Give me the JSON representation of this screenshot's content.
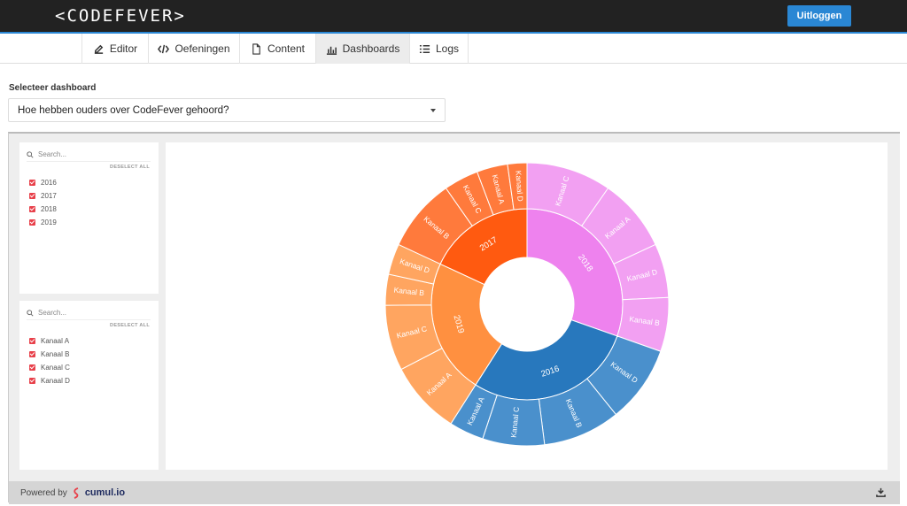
{
  "header": {
    "logo": "<CODEFEVER>",
    "logout_label": "Uitloggen"
  },
  "nav": {
    "tabs": [
      {
        "label": "Editor",
        "icon": "edit-icon"
      },
      {
        "label": "Oefeningen",
        "icon": "code-icon"
      },
      {
        "label": "Content",
        "icon": "file-icon"
      },
      {
        "label": "Dashboards",
        "icon": "bar-chart-icon",
        "active": true
      },
      {
        "label": "Logs",
        "icon": "list-icon"
      }
    ]
  },
  "selector": {
    "label": "Selecteer dashboard",
    "value": "Hoe hebben ouders over CodeFever gehoord?"
  },
  "filters": [
    {
      "placeholder": "Search...",
      "deselect": "DESELECT ALL",
      "items": [
        "2016",
        "2017",
        "2018",
        "2019"
      ]
    },
    {
      "placeholder": "Search...",
      "deselect": "DESELECT ALL",
      "items": [
        "Kanaal A",
        "Kanaal B",
        "Kanaal C",
        "Kanaal D"
      ]
    }
  ],
  "footer": {
    "powered_by": "Powered by",
    "brand": "cumul.io"
  },
  "chart_data": {
    "type": "sunburst",
    "colors": {
      "2018": "#ee82ee",
      "2016": "#2878bd",
      "2019": "#ff9040",
      "2017": "#ff5a10"
    },
    "outer_colors": {
      "2018": "#f2a0f2",
      "2016": "#4a90cc",
      "2019": "#ffa560",
      "2017": "#ff7a3c"
    },
    "groups": [
      {
        "name": "2018",
        "children": [
          {
            "name": "Kanaal C",
            "value": 11
          },
          {
            "name": "Kanaal A",
            "value": 9.5
          },
          {
            "name": "Kanaal D",
            "value": 7
          },
          {
            "name": "Kanaal B",
            "value": 7
          }
        ]
      },
      {
        "name": "2016",
        "children": [
          {
            "name": "Kanaal D",
            "value": 10
          },
          {
            "name": "Kanaal B",
            "value": 10
          },
          {
            "name": "Kanaal C",
            "value": 8
          },
          {
            "name": "Kanaal A",
            "value": 4.5
          }
        ]
      },
      {
        "name": "2019",
        "children": [
          {
            "name": "Kanaal A",
            "value": 9.5
          },
          {
            "name": "Kanaal C",
            "value": 8.5
          },
          {
            "name": "Kanaal B",
            "value": 4
          },
          {
            "name": "Kanaal D",
            "value": 4
          }
        ]
      },
      {
        "name": "2017",
        "children": [
          {
            "name": "Kanaal B",
            "value": 9.5
          },
          {
            "name": "Kanaal C",
            "value": 4.5
          },
          {
            "name": "Kanaal A",
            "value": 4
          },
          {
            "name": "Kanaal D",
            "value": 2.5
          }
        ]
      }
    ]
  }
}
